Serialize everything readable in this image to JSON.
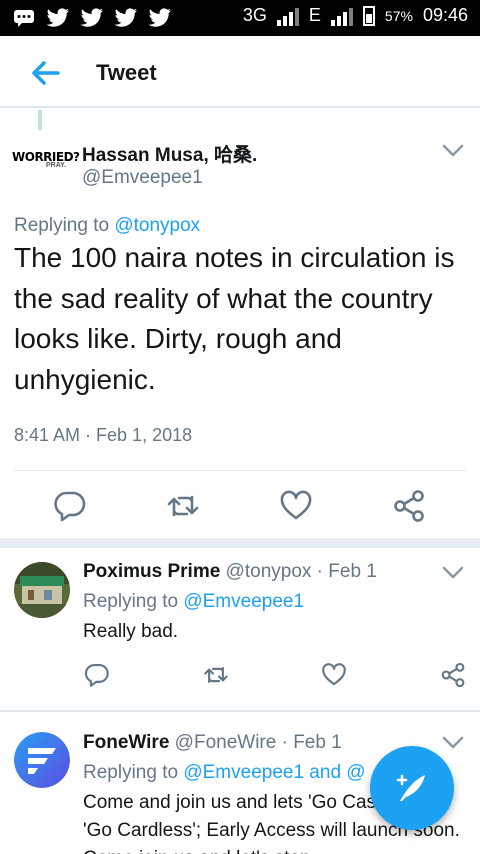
{
  "status_bar": {
    "network": "3G",
    "network2": "E",
    "battery": "57%",
    "time": "09:46",
    "notification_icons": [
      "message-icon",
      "twitter-icon",
      "twitter-icon",
      "twitter-icon",
      "twitter-icon"
    ]
  },
  "header": {
    "title": "Tweet"
  },
  "main_tweet": {
    "author_name": "Hassan Musa, 哈桑.",
    "author_handle": "@Emveepee1",
    "avatar_text_1": "WORRIED?",
    "avatar_text_2": "PRAY.",
    "replying_prefix": "Replying to ",
    "replying_to": "@tonypox",
    "text": "The 100 naira notes in circulation is the sad reality of what the country looks like. Dirty, rough and unhygienic.",
    "timestamp": "8:41 AM · Feb 1, 2018"
  },
  "replies": [
    {
      "name": "Poximus Prime",
      "handle_date": " @tonypox · Feb 1",
      "replying_prefix": "Replying to ",
      "replying_to": "@Emveepee1",
      "text": "Really bad."
    },
    {
      "name": "FoneWire",
      "handle_date": " @FoneWire · Feb 1",
      "replying_prefix": "Replying to ",
      "replying_to": "@Emveepee1 and @",
      "text": "Come and join us and lets 'Go Cashless' & 'Go Cardless'; Early Access will launch soon. Come join us and let's stop"
    }
  ],
  "colors": {
    "accent": "#1da1f2",
    "muted": "#657786",
    "text": "#14171a"
  }
}
